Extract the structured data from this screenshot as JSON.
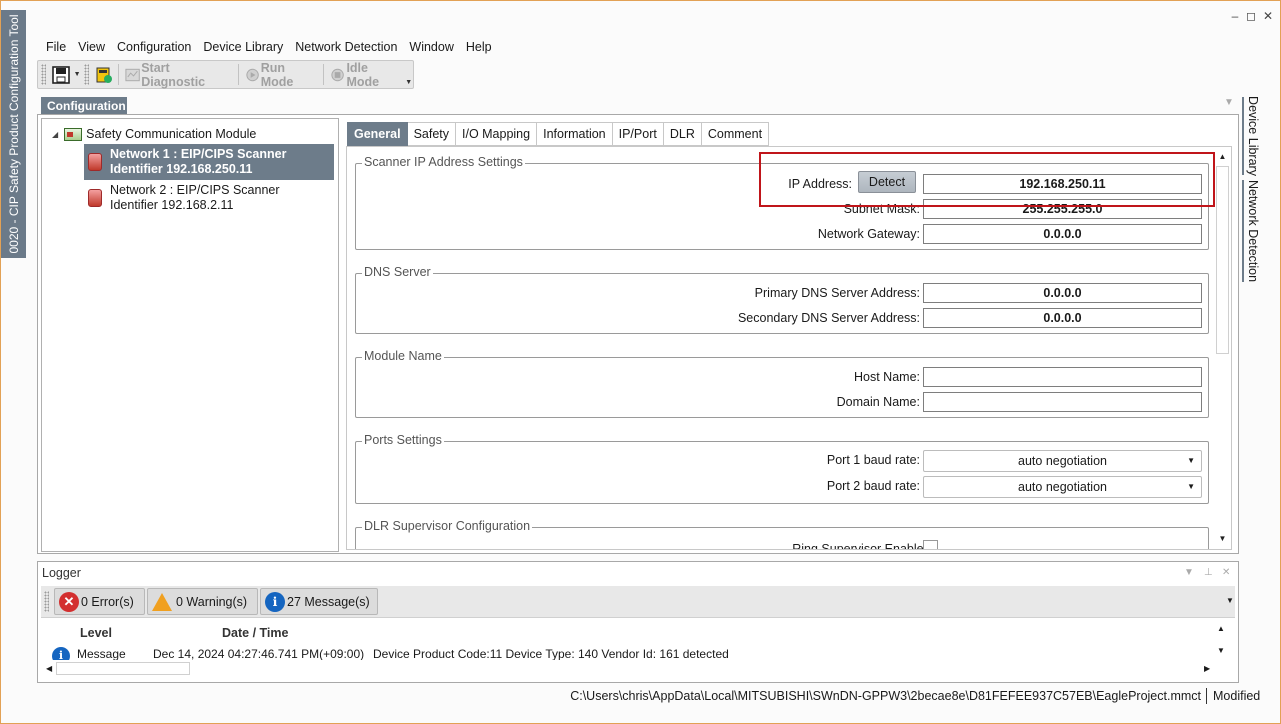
{
  "app": {
    "title": "0020 - CIP Safety Product Configuration Tool",
    "window_controls": [
      "–",
      "◻",
      "✕"
    ]
  },
  "menu": [
    "File",
    "View",
    "Configuration",
    "Device Library",
    "Network Detection",
    "Window",
    "Help"
  ],
  "toolbar": {
    "start_diagnostic": "Start Diagnostic",
    "run_mode": "Run Mode",
    "idle_mode": "Idle Mode"
  },
  "config_panel": {
    "title": "Configuration",
    "tree": {
      "root": "Safety Communication Module",
      "nodes": [
        {
          "line1": "Network 1 : EIP/CIPS Scanner",
          "line2": "Identifier 192.168.250.11",
          "selected": true
        },
        {
          "line1": "Network 2 : EIP/CIPS Scanner",
          "line2": "Identifier 192.168.2.11",
          "selected": false
        }
      ]
    },
    "tabs": [
      "General",
      "Safety",
      "I/O Mapping",
      "Information",
      "IP/Port",
      "DLR",
      "Comment"
    ],
    "active_tab": "General"
  },
  "general": {
    "scanner_ip": {
      "title": "Scanner IP Address Settings",
      "ip_label": "IP Address:",
      "detect_label": "Detect",
      "ip_value": "192.168.250.11",
      "subnet_label": "Subnet Mask:",
      "subnet_value": "255.255.255.0",
      "gateway_label": "Network Gateway:",
      "gateway_value": "0.0.0.0"
    },
    "dns": {
      "title": "DNS Server",
      "primary_label": "Primary DNS Server Address:",
      "primary_value": "0.0.0.0",
      "secondary_label": "Secondary DNS Server Address:",
      "secondary_value": "0.0.0.0"
    },
    "module_name": {
      "title": "Module Name",
      "host_label": "Host Name:",
      "host_value": "",
      "domain_label": "Domain Name:",
      "domain_value": ""
    },
    "ports": {
      "title": "Ports Settings",
      "port1_label": "Port 1 baud rate:",
      "port1_value": "auto negotiation",
      "port2_label": "Port 2 baud rate:",
      "port2_value": "auto negotiation"
    },
    "dlr": {
      "title": "DLR Supervisor Configuration",
      "ring_label": "Ring Supervisor Enabled:"
    }
  },
  "dock": {
    "device_library": "Device Library",
    "network_detection": "Network Detection"
  },
  "logger": {
    "title": "Logger",
    "errors": "0 Error(s)",
    "warnings": "0 Warning(s)",
    "messages": "27 Message(s)",
    "col_level": "Level",
    "col_datetime": "Date / Time",
    "row": {
      "level": "Message",
      "datetime": "Dec 14, 2024 04:27:46.741 PM(+09:00)",
      "text": "Device Product Code:11 Device Type: 140 Vendor Id: 161 detected"
    }
  },
  "status": {
    "path": "C:\\Users\\chris\\AppData\\Local\\MITSUBISHI\\SWnDN-GPPW3\\2becae8e\\D81FEFEE937C57EB\\EagleProject.mmct",
    "state": "Modified"
  },
  "colors": {
    "accent": "#6d7c8a",
    "highlight_box": "#c0151a",
    "window_border": "#e2a155"
  }
}
